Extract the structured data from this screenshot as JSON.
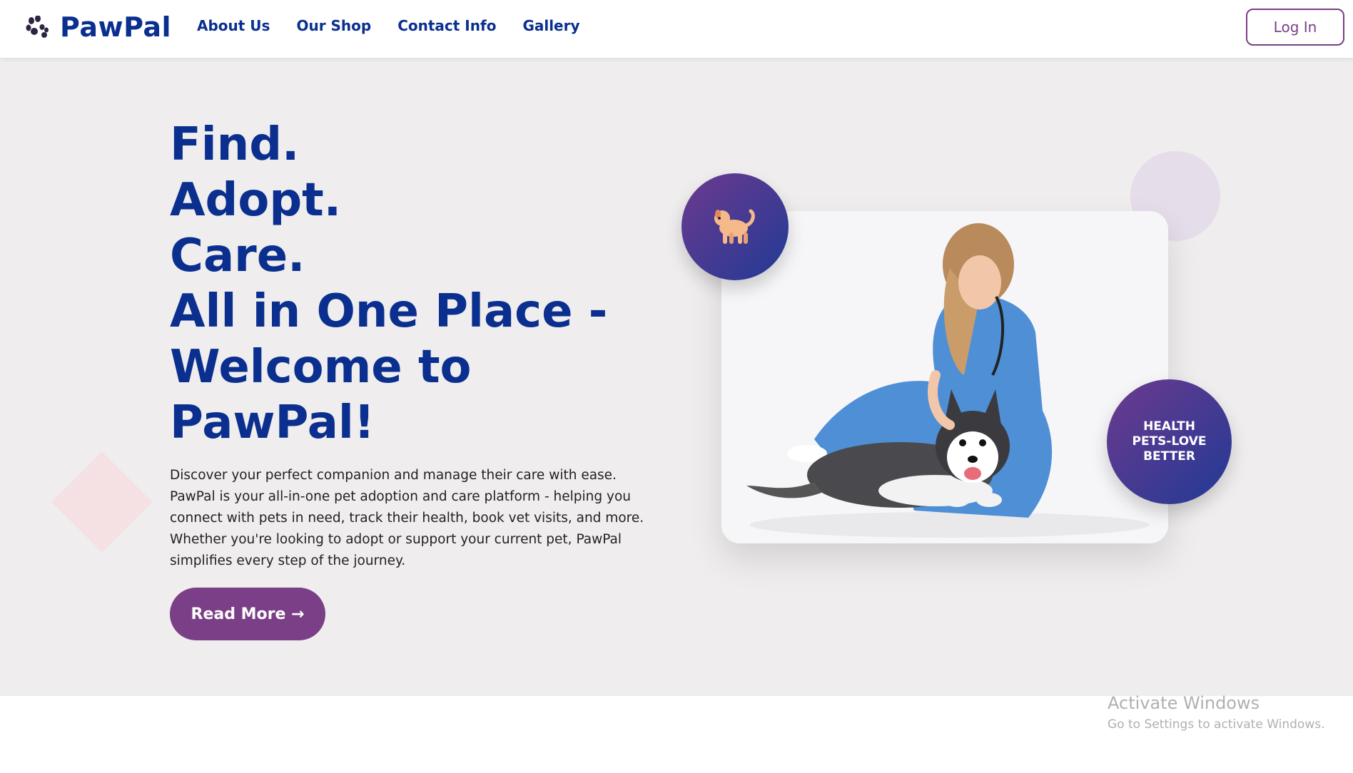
{
  "header": {
    "brand": "PawPal",
    "nav": [
      "About Us",
      "Our Shop",
      "Contact Info",
      "Gallery"
    ],
    "login_label": "Log In"
  },
  "hero": {
    "headline": [
      "Find.",
      "Adopt.",
      "Care.",
      "All in One Place -",
      "Welcome to",
      "PawPal!"
    ],
    "description": "Discover your perfect companion and manage their care with ease. PawPal is your all-in-one pet adoption and care platform - helping you connect with pets in need, track their health, book vet visits, and more. Whether you're looking to adopt or support your current pet, PawPal simplifies every step of the journey.",
    "cta_label": "Read More →",
    "badge_lines": [
      "HEALTH",
      "PETS-LOVE",
      "BETTER"
    ]
  },
  "watermark": {
    "title": "Activate Windows",
    "subtitle": "Go to Settings to activate Windows."
  },
  "colors": {
    "brand_blue": "#0a2f8f",
    "accent_purple": "#7a3f86",
    "hero_bg": "#efeded"
  },
  "icons": [
    "paw-icon",
    "dog-icon"
  ]
}
